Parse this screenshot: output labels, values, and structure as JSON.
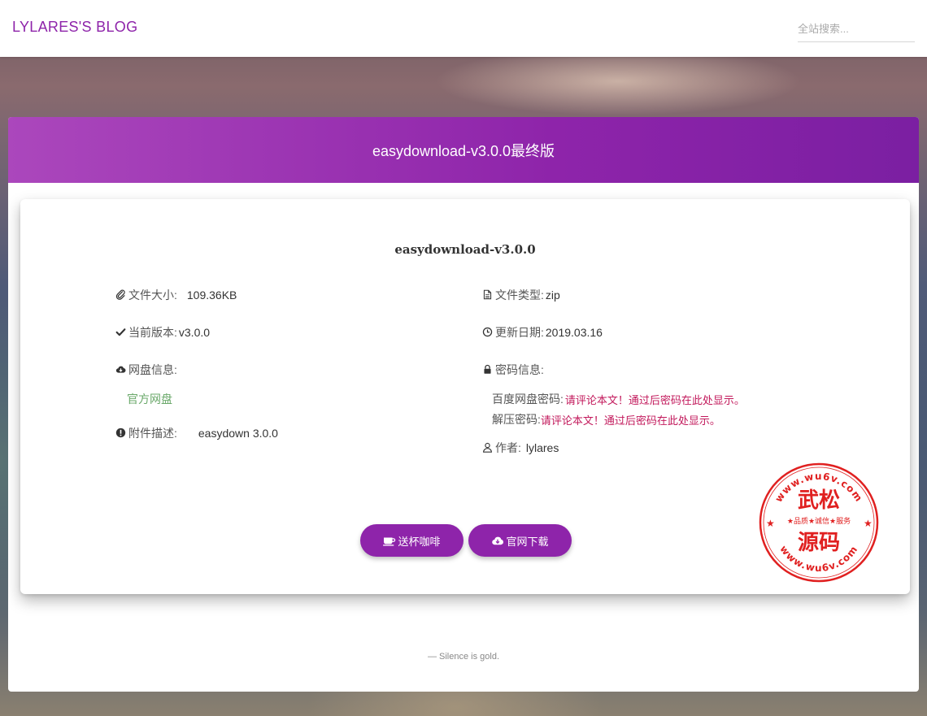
{
  "navbar": {
    "brand": "LYLARES'S BLOG",
    "search_placeholder": "全站搜索..."
  },
  "panel": {
    "header_title": "easydownload-v3.0.0最终版",
    "card_title": "easydownload-v3.0.0"
  },
  "details": {
    "size_label": "文件大小:",
    "size_value": "109.36KB",
    "type_label": "文件类型:",
    "type_value": "zip",
    "version_label": "当前版本:",
    "version_value": "v3.0.0",
    "date_label": "更新日期:",
    "date_value": "2019.03.16",
    "netdisk_label": "网盘信息:",
    "netdisk_link": "官方网盘",
    "password_label": "密码信息:",
    "baidu_pwd_label": "百度网盘密码:",
    "baidu_pwd_hint": "请评论本文！通过后密码在此处显示。",
    "unzip_pwd_label": "解压密码:",
    "unzip_pwd_hint": "请评论本文！通过后密码在此处显示。",
    "desc_label": "附件描述:",
    "desc_value": "easydown 3.0.0",
    "author_label": "作者:",
    "author_value": "lylares"
  },
  "buttons": {
    "coffee": "送杯咖啡",
    "download": "官网下载"
  },
  "footer": {
    "quote": "— Silence is gold."
  },
  "stamp": {
    "top_arc": "www.wu6v.com",
    "line1": "武松",
    "middle": "★品质★诚信★服务",
    "line2": "源码",
    "bottom_arc": "www.wu6v.com"
  },
  "colors": {
    "accent": "#8e24aa",
    "link_green": "#6aa86a",
    "hint_red": "#c2185b",
    "stamp_red": "#e02020"
  },
  "icons": [
    "paperclip-icon",
    "file-icon",
    "check-icon",
    "clock-icon",
    "cloud-download-icon",
    "lock-icon",
    "info-icon",
    "user-icon",
    "coffee-icon"
  ]
}
